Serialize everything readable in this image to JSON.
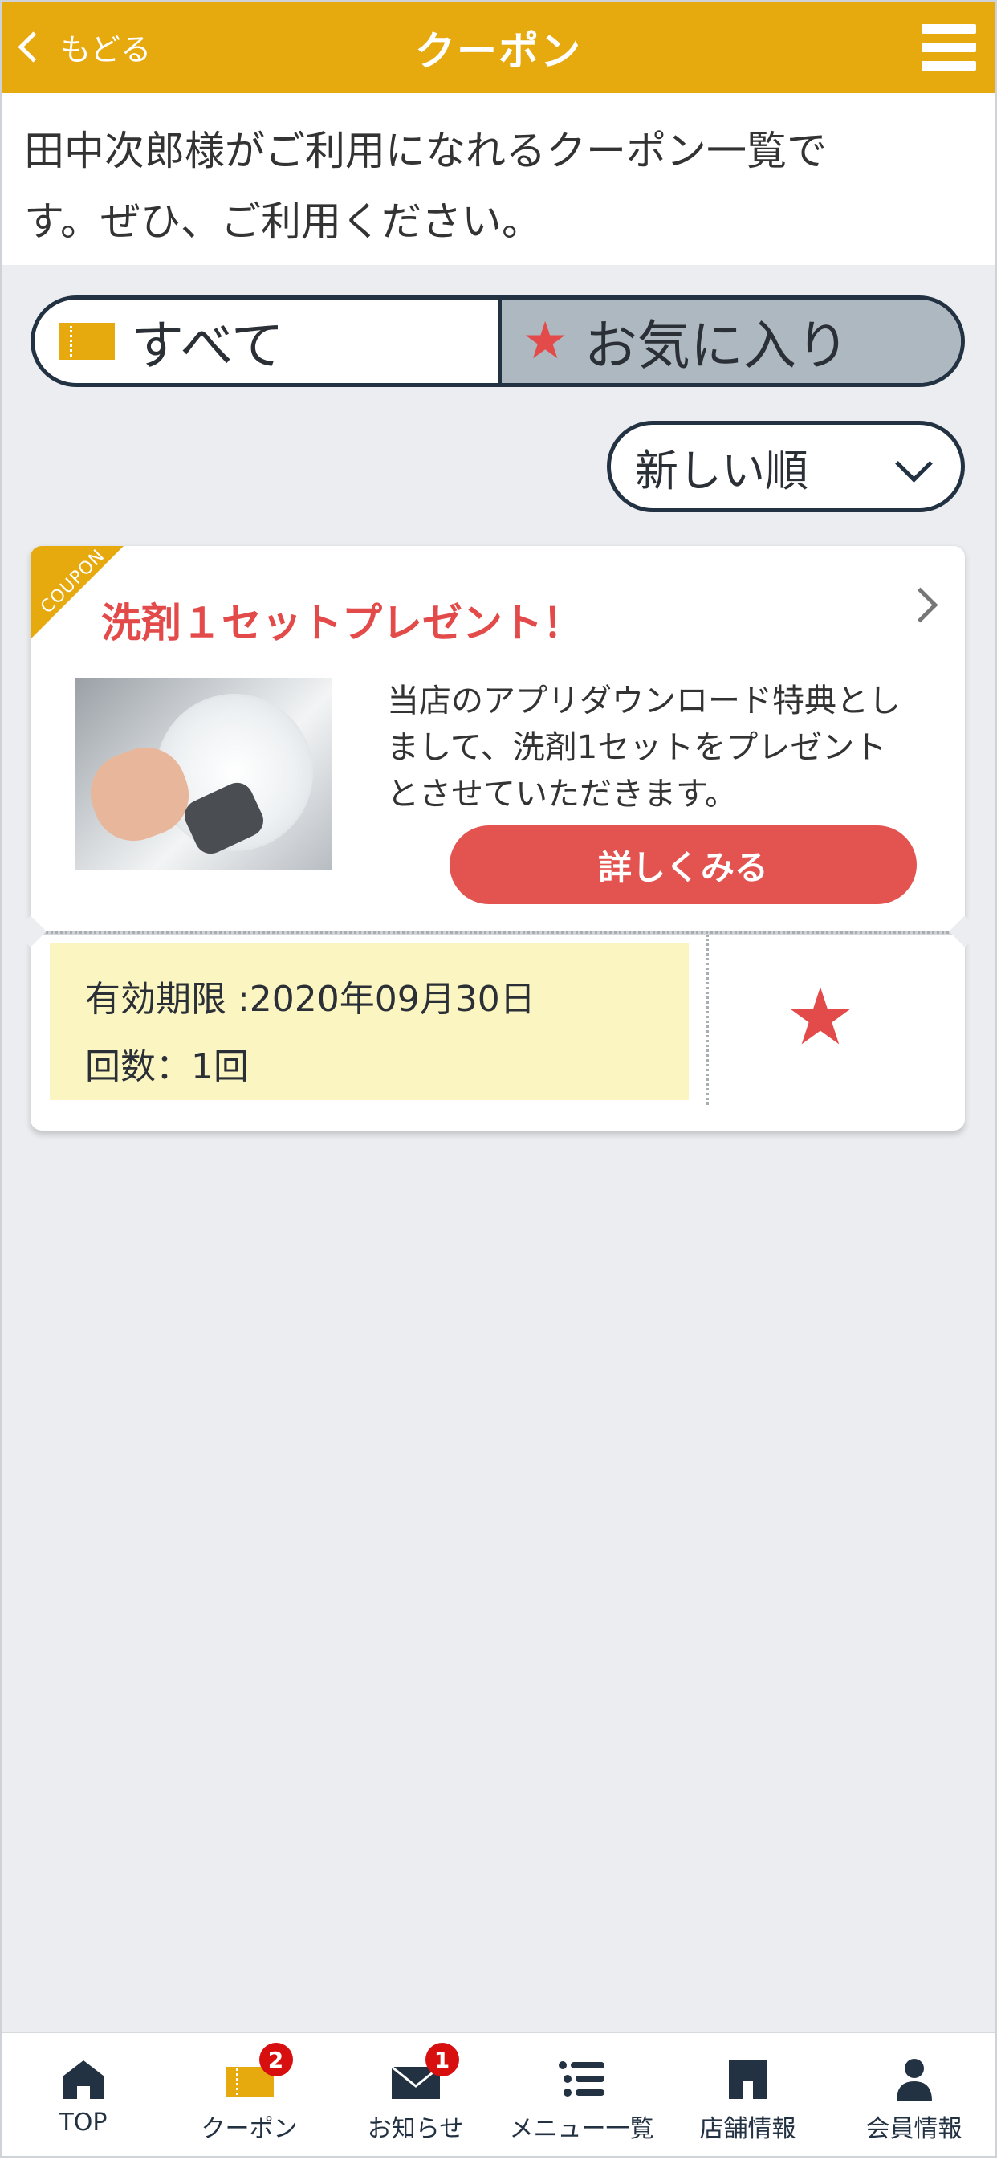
{
  "header": {
    "back_label": "もどる",
    "title": "クーポン"
  },
  "intro": {
    "line1": "田中次郎様がご利用になれるクーポン一覧で",
    "line2": "す。ぜひ、ご利用ください。"
  },
  "tabs": [
    {
      "label": "すべて",
      "icon": "ticket-icon",
      "selected": true
    },
    {
      "label": "お気に入り",
      "icon": "star-icon",
      "selected": false
    }
  ],
  "sort": {
    "selected": "新しい順"
  },
  "coupon": {
    "corner_label": "COUPON",
    "title": "洗剤１セットプレゼント！",
    "description_line1": "当店のアプリダウンロード特典とし",
    "description_line2": "まして、洗剤1セットをプレゼント",
    "description_line3": "とさせていただきます。",
    "detail_button": "詳しくみる",
    "validity": "有効期限 :2020年09月30日",
    "count": "回数：1回",
    "favorited": true
  },
  "nav": [
    {
      "label": "TOP",
      "icon": "home-icon"
    },
    {
      "label": "クーポン",
      "icon": "coupon-icon",
      "badge": "2"
    },
    {
      "label": "お知らせ",
      "icon": "mail-icon",
      "badge": "1"
    },
    {
      "label": "メニュー一覧",
      "icon": "menu-list-icon"
    },
    {
      "label": "店舗情報",
      "icon": "store-icon"
    },
    {
      "label": "会員情報",
      "icon": "person-icon"
    }
  ],
  "colors": {
    "brand": "#e6a90e",
    "accent_red": "#e34b4a",
    "navy": "#233243",
    "badge_red": "#d7100f"
  }
}
